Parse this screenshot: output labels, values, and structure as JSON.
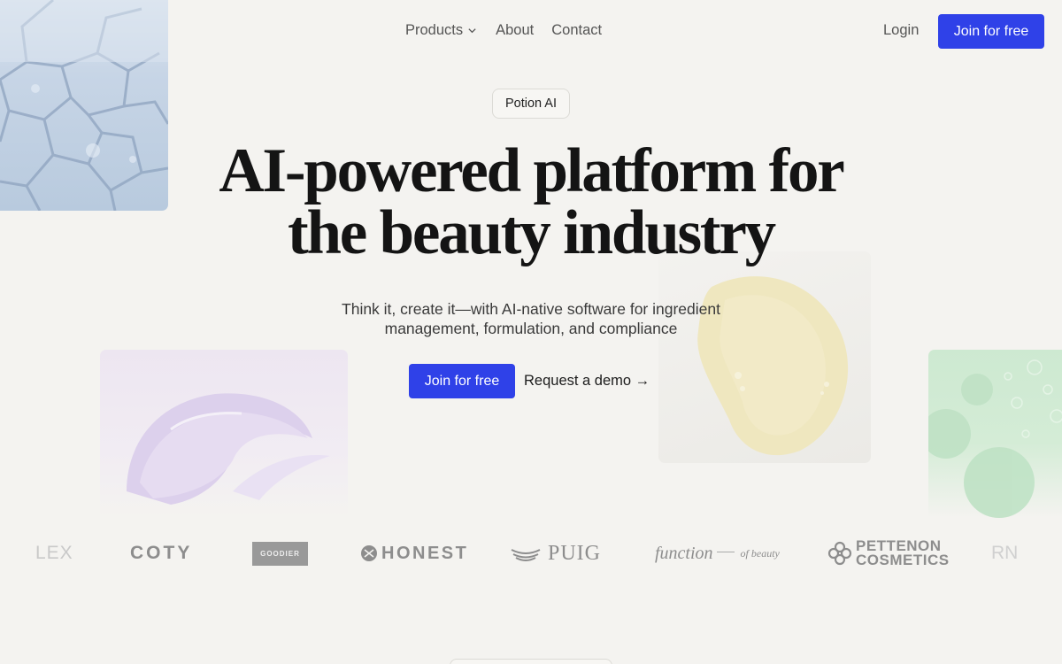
{
  "nav": {
    "products": "Products",
    "about": "About",
    "contact": "Contact",
    "login": "Login",
    "join": "Join for free"
  },
  "hero": {
    "badge": "Potion AI",
    "headline_line1": "AI-powered platform for",
    "headline_line2": "the beauty industry",
    "subhead": "Think it, create it—with AI-native software for ingredient management, formulation, and compliance",
    "cta_primary": "Join for free",
    "cta_secondary": "Request a demo →"
  },
  "logos": {
    "alex": "LEX",
    "coty": "COTY",
    "goodier": "GOODIER",
    "honest": "HONEST",
    "puig": "PUIG",
    "function": "function",
    "function_suffix": "of beauty",
    "parthenon_1": "PETTENON",
    "parthenon_2": "COSMETICS",
    "rn": "RN"
  },
  "colors": {
    "accent": "#2f41e8",
    "background": "#f4f3f0"
  },
  "icons": {
    "logo": "flower-logo-icon",
    "products_chevron": "chevron-down-icon"
  }
}
